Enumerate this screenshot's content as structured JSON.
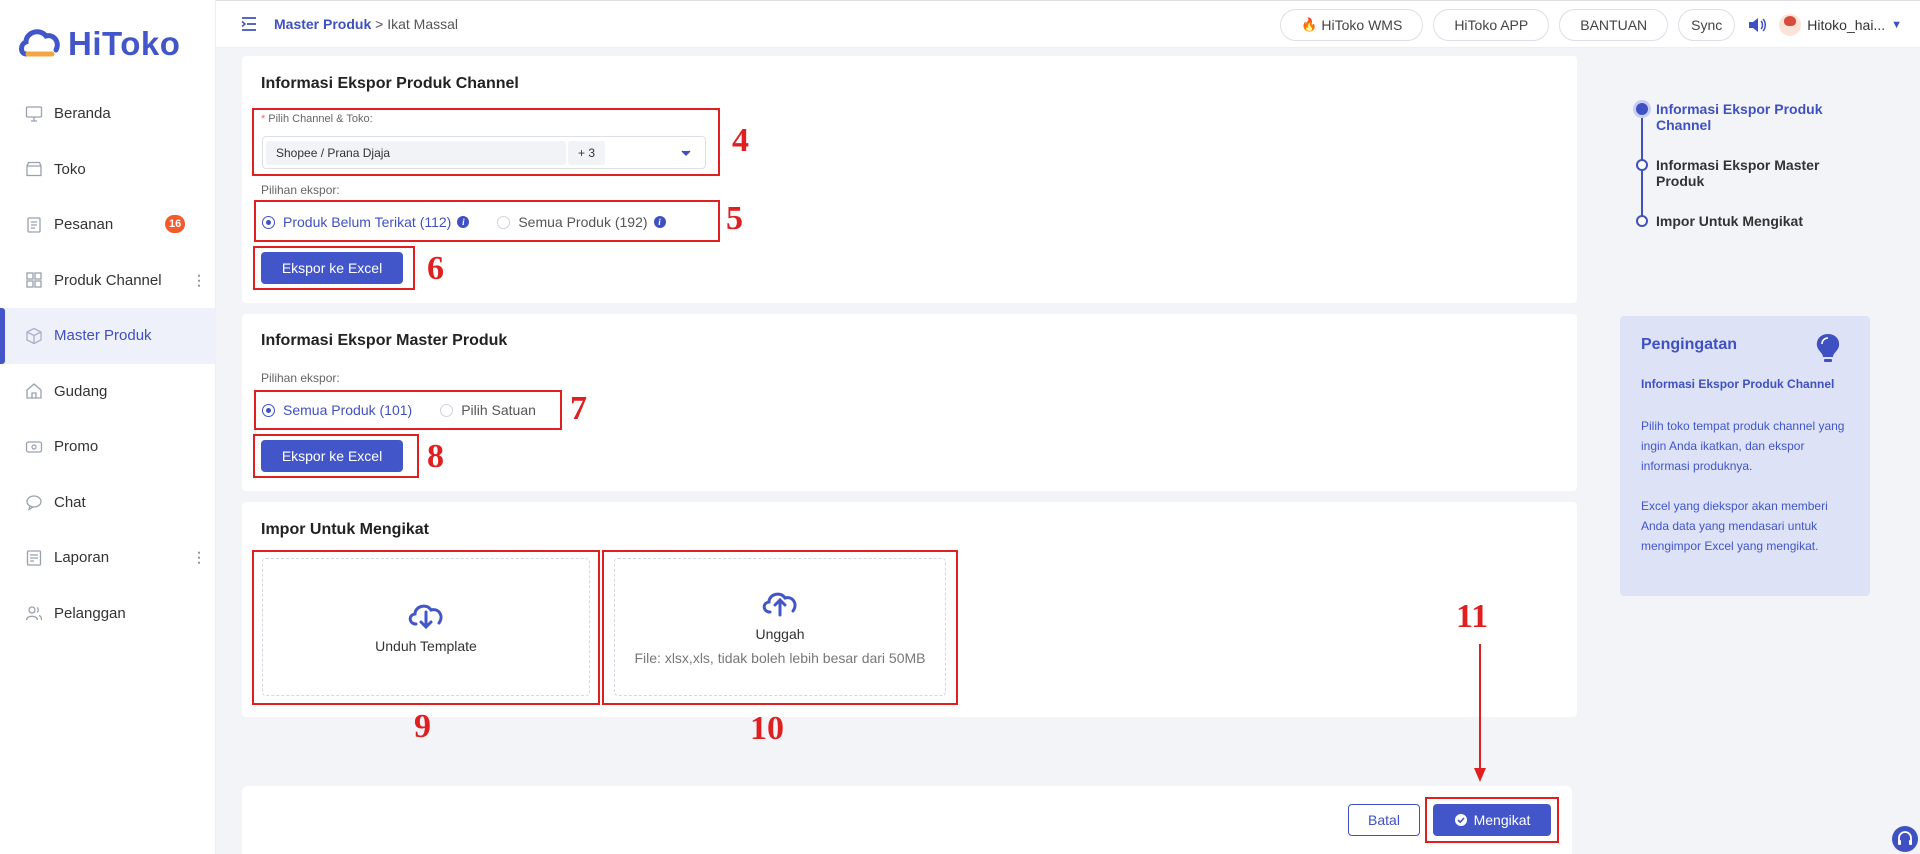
{
  "brand": {
    "name": "HiToko",
    "color": "#4256c9"
  },
  "sidebar": {
    "items": [
      {
        "label": "Beranda",
        "icon": "monitor-icon"
      },
      {
        "label": "Toko",
        "icon": "store-icon"
      },
      {
        "label": "Pesanan",
        "icon": "orders-icon",
        "badge": "16"
      },
      {
        "label": "Produk Channel",
        "icon": "grid-icon",
        "more": "⋮"
      },
      {
        "label": "Master Produk",
        "icon": "box-icon"
      },
      {
        "label": "Gudang",
        "icon": "warehouse-icon"
      },
      {
        "label": "Promo",
        "icon": "promo-icon"
      },
      {
        "label": "Chat",
        "icon": "chat-icon"
      },
      {
        "label": "Laporan",
        "icon": "report-icon",
        "more": "⋮"
      },
      {
        "label": "Pelanggan",
        "icon": "users-icon"
      }
    ]
  },
  "header": {
    "breadcrumb": {
      "parent": "Master Produk",
      "sep": " > ",
      "current": "Ikat Massal"
    },
    "buttons": {
      "wms": "HiToko WMS",
      "app": "HiToko APP",
      "help": "BANTUAN",
      "sync": "Sync"
    },
    "user": "Hitoko_hai..."
  },
  "section1": {
    "title": "Informasi Ekspor Produk Channel",
    "channel_label": "Pilih Channel & Toko:",
    "required_mark": "*",
    "selected_tag": "Shopee / Prana Djaja",
    "more_tag": "+ 3",
    "export_option_label": "Pilihan ekspor:",
    "options": [
      {
        "label": "Produk Belum Terikat (112)",
        "checked": true
      },
      {
        "label": "Semua Produk (192)",
        "checked": false
      }
    ],
    "export_button": "Ekspor ke Excel"
  },
  "section2": {
    "title": "Informasi Ekspor Master Produk",
    "export_option_label": "Pilihan ekspor:",
    "options": [
      {
        "label": "Semua Produk (101)",
        "checked": true
      },
      {
        "label": "Pilih Satuan",
        "checked": false
      }
    ],
    "export_button": "Ekspor ke Excel"
  },
  "section3": {
    "title": "Impor Untuk Mengikat",
    "download_label": "Unduh Template",
    "upload_label": "Unggah",
    "upload_hint": "File: xlsx,xls, tidak boleh lebih besar dari 50MB"
  },
  "steps": [
    {
      "label": "Informasi Ekspor Produk Channel",
      "active": true
    },
    {
      "label": "Informasi Ekspor Master Produk",
      "active": false
    },
    {
      "label": "Impor Untuk Mengikat",
      "active": false
    }
  ],
  "tips": {
    "title": "Pengingatan",
    "subtitle": "Informasi Ekspor Produk Channel",
    "body": [
      "Pilih toko tempat produk channel yang ingin Anda ikatkan, dan ekspor informasi produknya.",
      "Excel yang diekspor akan memberi Anda data yang mendasari untuk mengimpor Excel yang mengikat."
    ]
  },
  "footer": {
    "cancel": "Batal",
    "bind": "Mengikat"
  },
  "annotations": [
    "4",
    "5",
    "6",
    "7",
    "8",
    "9",
    "10",
    "11"
  ]
}
